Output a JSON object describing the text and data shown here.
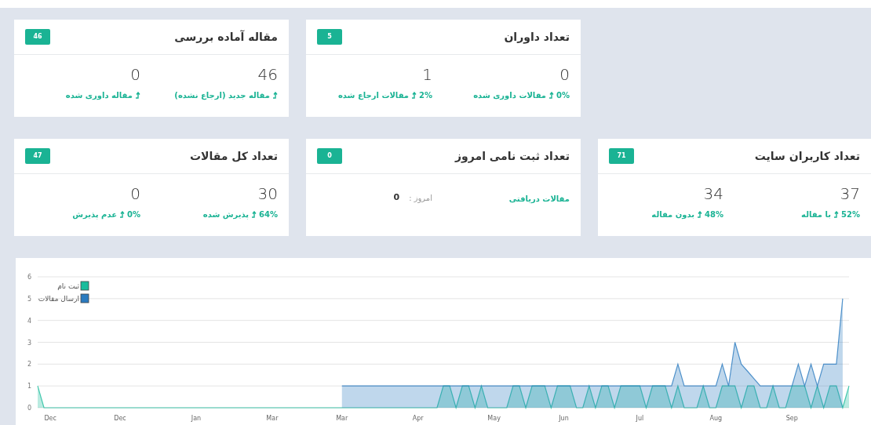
{
  "card_rows": [
    [
      {
        "title": "تعداد داوران",
        "badge": "5",
        "body": {
          "kind": "stats",
          "stats": [
            {
              "value": "0",
              "percent": "0%",
              "label": "مقالات داوری شده"
            },
            {
              "value": "1",
              "percent": "2%",
              "label": "مقالات ارجاع شده"
            }
          ]
        }
      },
      {
        "title": "مقاله آماده بررسی",
        "badge": "46",
        "body": {
          "kind": "stats",
          "stats": [
            {
              "value": "46",
              "label": "مقاله جدید (ارجاع نشده)"
            },
            {
              "value": "0",
              "label": "مقاله داوری شده"
            }
          ]
        }
      }
    ],
    [
      {
        "title": "تعداد کاربران سایت",
        "badge": "71",
        "body": {
          "kind": "stats",
          "stats": [
            {
              "value": "37",
              "percent": "52%",
              "label": "با مقاله"
            },
            {
              "value": "34",
              "percent": "48%",
              "label": "بدون مقاله"
            }
          ]
        }
      },
      {
        "title": "تعداد ثبت نامی امروز",
        "badge": "0",
        "body": {
          "kind": "today",
          "label": "مقالات دریافتی",
          "today_label": "امروز :",
          "today_value": "0"
        }
      },
      {
        "title": "تعداد کل مقالات",
        "badge": "47",
        "body": {
          "kind": "stats",
          "stats": [
            {
              "value": "30",
              "percent": "64%",
              "label": "پذیرش شده"
            },
            {
              "value": "0",
              "percent": "0%",
              "label": "عدم پذیرش"
            }
          ]
        }
      }
    ]
  ],
  "chart": {
    "chart_data": {
      "type": "area",
      "grid": true,
      "legend": "upper left",
      "ylim": [
        0,
        6
      ],
      "yticks": [
        0,
        1,
        2,
        3,
        4,
        5,
        6
      ],
      "categories": [
        null,
        null,
        "Dec",
        null,
        null,
        null,
        null,
        null,
        null,
        null,
        null,
        null,
        null,
        "Dec",
        null,
        null,
        null,
        null,
        null,
        null,
        null,
        null,
        null,
        null,
        null,
        "Jan",
        null,
        null,
        null,
        null,
        null,
        null,
        null,
        null,
        null,
        null,
        null,
        "Mar",
        null,
        null,
        null,
        null,
        null,
        null,
        null,
        null,
        null,
        null,
        "Mar",
        null,
        null,
        null,
        null,
        null,
        null,
        null,
        null,
        null,
        null,
        null,
        "Apr",
        null,
        null,
        null,
        null,
        null,
        null,
        null,
        null,
        null,
        null,
        null,
        "May",
        null,
        null,
        null,
        null,
        null,
        null,
        null,
        null,
        null,
        null,
        "Jun",
        null,
        null,
        null,
        null,
        null,
        null,
        null,
        null,
        null,
        null,
        null,
        "Jul",
        null,
        null,
        null,
        null,
        null,
        null,
        null,
        null,
        null,
        null,
        null,
        "Aug",
        null,
        null,
        null,
        null,
        null,
        null,
        null,
        null,
        null,
        null,
        null,
        "Sep",
        null,
        null,
        null,
        null,
        null,
        null,
        null,
        null,
        null
      ],
      "series": [
        {
          "name": "ثبت نام",
          "color": "#1abc9c",
          "values": [
            1,
            0,
            0,
            0,
            0,
            0,
            0,
            0,
            0,
            0,
            0,
            0,
            0,
            0,
            0,
            0,
            0,
            0,
            0,
            0,
            0,
            0,
            0,
            0,
            0,
            0,
            0,
            0,
            0,
            0,
            0,
            0,
            0,
            0,
            0,
            0,
            0,
            0,
            0,
            0,
            0,
            0,
            0,
            0,
            0,
            0,
            0,
            0,
            0,
            0,
            0,
            0,
            0,
            0,
            0,
            0,
            0,
            0,
            0,
            0,
            0,
            0,
            0,
            0,
            1,
            1,
            0,
            1,
            1,
            0,
            1,
            0,
            0,
            0,
            0,
            1,
            1,
            0,
            1,
            1,
            1,
            0,
            1,
            1,
            1,
            0,
            0,
            1,
            0,
            1,
            1,
            0,
            1,
            1,
            1,
            1,
            0,
            1,
            1,
            1,
            0,
            1,
            0,
            0,
            0,
            1,
            0,
            0,
            1,
            1,
            1,
            0,
            1,
            1,
            0,
            0,
            1,
            0,
            0,
            1,
            1,
            1,
            0,
            1,
            0,
            1,
            1,
            0,
            1
          ]
        },
        {
          "name": "ارسال مقالات",
          "color": "#2b7bbf",
          "values": [
            null,
            null,
            null,
            null,
            null,
            null,
            null,
            null,
            null,
            null,
            null,
            null,
            null,
            null,
            null,
            null,
            null,
            null,
            null,
            null,
            null,
            null,
            null,
            null,
            null,
            null,
            null,
            null,
            null,
            null,
            null,
            null,
            null,
            null,
            null,
            null,
            null,
            null,
            null,
            null,
            null,
            null,
            null,
            null,
            null,
            null,
            null,
            null,
            1,
            1,
            1,
            1,
            1,
            1,
            1,
            1,
            1,
            1,
            1,
            1,
            1,
            1,
            1,
            1,
            1,
            1,
            1,
            1,
            1,
            1,
            1,
            1,
            1,
            1,
            1,
            1,
            1,
            1,
            1,
            1,
            1,
            1,
            1,
            1,
            1,
            1,
            1,
            1,
            1,
            1,
            1,
            1,
            1,
            1,
            1,
            1,
            1,
            1,
            1,
            1,
            1,
            2,
            1,
            1,
            1,
            1,
            1,
            1,
            2,
            1,
            3,
            2,
            1.67,
            1.33,
            1,
            1,
            1,
            1,
            1,
            1,
            2,
            1,
            2,
            1,
            2,
            2,
            2,
            5,
            null
          ]
        }
      ]
    }
  }
}
